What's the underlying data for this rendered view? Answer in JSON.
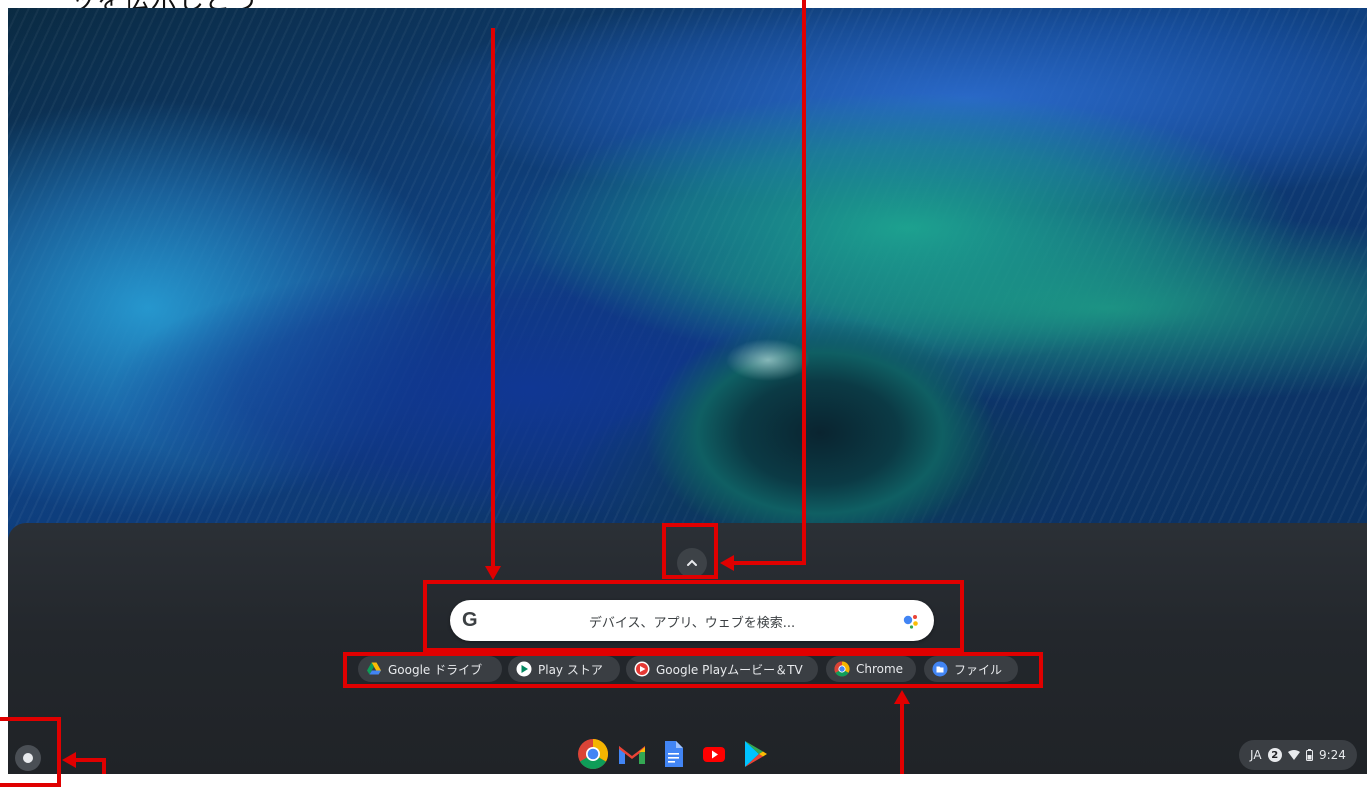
{
  "caption": {
    "text": "ッを伝示しどう"
  },
  "launcher": {
    "search_placeholder": "デバイス、アプリ、ウェブを検索...",
    "search_logo": "G",
    "expand_icon": "chevron-up-icon",
    "suggested_apps": [
      {
        "label": "Google ドライブ",
        "icon": "google-drive-icon"
      },
      {
        "label": "Play ストア",
        "icon": "play-store-icon"
      },
      {
        "label": "Google Playムービー＆TV",
        "icon": "play-movies-icon"
      },
      {
        "label": "Chrome",
        "icon": "chrome-icon"
      },
      {
        "label": "ファイル",
        "icon": "files-icon"
      }
    ]
  },
  "shelf": {
    "apps": [
      {
        "name": "Chrome",
        "icon": "chrome-icon"
      },
      {
        "name": "Gmail",
        "icon": "gmail-icon"
      },
      {
        "name": "Google Docs",
        "icon": "docs-icon"
      },
      {
        "name": "YouTube",
        "icon": "youtube-icon"
      },
      {
        "name": "Play Store",
        "icon": "play-store-icon"
      }
    ]
  },
  "tray": {
    "ime": "JA",
    "notification_count": "2",
    "time": "9:24"
  },
  "colors": {
    "annotation": "#e00000",
    "panel": "#23272c",
    "chip": "#3a3e43"
  }
}
